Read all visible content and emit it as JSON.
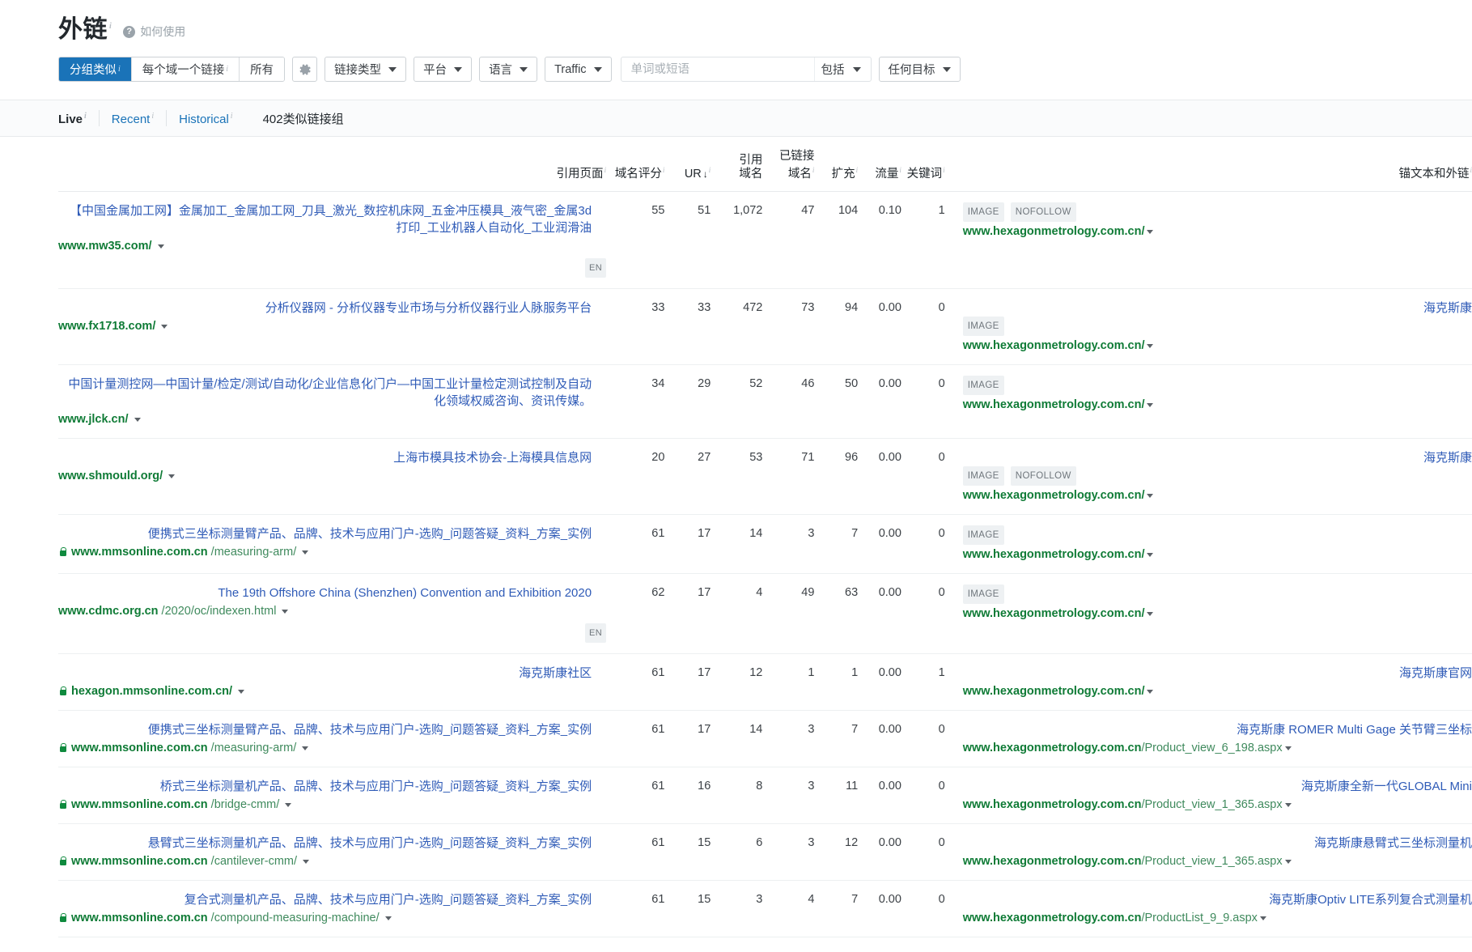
{
  "header": {
    "title": "外链",
    "title_sup": "i",
    "help_icon": "question-circle-icon",
    "help_label": "如何使用"
  },
  "toolbar": {
    "segments": [
      {
        "label": "分组类似",
        "sup": "i",
        "active": true
      },
      {
        "label": "每个域一个链接",
        "sup": "i",
        "active": false
      },
      {
        "label": "所有",
        "sup": "",
        "active": false
      }
    ],
    "gear_icon": "gear-icon",
    "dropdowns": [
      {
        "label": "链接类型"
      },
      {
        "label": "平台"
      },
      {
        "label": "语言"
      },
      {
        "label": "Traffic"
      }
    ],
    "search": {
      "placeholder": "单词或短语",
      "value": "",
      "mode_label": "包括"
    },
    "target_dropdown": {
      "label": "任何目标"
    }
  },
  "tabs": {
    "items": [
      {
        "label": "Live",
        "sup": "i",
        "active": true
      },
      {
        "label": "Recent",
        "sup": "i",
        "active": false
      },
      {
        "label": "Historical",
        "sup": "i",
        "active": false
      }
    ],
    "group_count": "402类似链接组"
  },
  "table": {
    "headers": [
      {
        "key": "page",
        "label": "引用页面",
        "sup": "i",
        "align": "left"
      },
      {
        "key": "dr",
        "label": "域名评分",
        "sup": "i",
        "align": "right"
      },
      {
        "key": "ur",
        "label": "UR",
        "sup": "i",
        "align": "right",
        "sorted": "desc",
        "sort_glyph": "↓"
      },
      {
        "key": "ref_domains",
        "label": "引用\n域名",
        "sup": "",
        "align": "right"
      },
      {
        "key": "linked_domains",
        "label": "已链接\n域名",
        "sup": "i",
        "align": "right"
      },
      {
        "key": "ext",
        "label": "扩充",
        "sup": "i",
        "align": "right"
      },
      {
        "key": "traffic",
        "label": "流量",
        "sup": "i",
        "align": "right"
      },
      {
        "key": "keywords",
        "label": "关键词",
        "sup": "i",
        "align": "right"
      },
      {
        "key": "anchor",
        "label": "锚文本和外链",
        "sup": "i",
        "align": "left"
      }
    ],
    "rows": [
      {
        "title": "【中国金属加工网】金属加工_金属加工网_刀具_激光_数控机床网_五金冲压模具_液气密_金属3d打印_工业机器人自动化_工业润滑油",
        "secure": false,
        "domain": "www.mw35.com/",
        "path": "",
        "lang": "EN",
        "dr": "55",
        "ur": "51",
        "ref_domains": "1,072",
        "linked_domains": "47",
        "ext": "104",
        "traffic": "0.10",
        "keywords": "1",
        "badges": [
          "IMAGE",
          "NOFOLLOW"
        ],
        "anchor_text": "",
        "anchor_domain": "www.hexagonmetrology.com.cn/",
        "anchor_path": ""
      },
      {
        "title": "分析仪器网 - 分析仪器专业市场与分析仪器行业人脉服务平台",
        "secure": false,
        "domain": "www.fx1718.com/",
        "path": "",
        "lang": "",
        "dr": "33",
        "ur": "33",
        "ref_domains": "472",
        "linked_domains": "73",
        "ext": "94",
        "traffic": "0.00",
        "keywords": "0",
        "badges": [
          "IMAGE"
        ],
        "anchor_text": "海克斯康",
        "anchor_domain": "www.hexagonmetrology.com.cn/",
        "anchor_path": ""
      },
      {
        "title": "中国计量测控网—中国计量/检定/测试/自动化/企业信息化门户—中国工业计量检定测试控制及自动化领域权威咨询、资讯传媒。",
        "secure": false,
        "domain": "www.jlck.cn/",
        "path": "",
        "lang": "",
        "dr": "34",
        "ur": "29",
        "ref_domains": "52",
        "linked_domains": "46",
        "ext": "50",
        "traffic": "0.00",
        "keywords": "0",
        "badges": [
          "IMAGE"
        ],
        "anchor_text": "",
        "anchor_domain": "www.hexagonmetrology.com.cn/",
        "anchor_path": ""
      },
      {
        "title": "上海市模具技术协会-上海模具信息网",
        "secure": false,
        "domain": "www.shmould.org/",
        "path": "",
        "lang": "",
        "dr": "20",
        "ur": "27",
        "ref_domains": "53",
        "linked_domains": "71",
        "ext": "96",
        "traffic": "0.00",
        "keywords": "0",
        "badges": [
          "IMAGE",
          "NOFOLLOW"
        ],
        "anchor_text": "海克斯康",
        "anchor_domain": "www.hexagonmetrology.com.cn/",
        "anchor_path": ""
      },
      {
        "title": "便携式三坐标测量臂产品、品牌、技术与应用门户-选购_问题答疑_资料_方案_实例",
        "secure": true,
        "domain": "www.mmsonline.com.cn",
        "path": "/measuring-arm/",
        "lang": "",
        "dr": "61",
        "ur": "17",
        "ref_domains": "14",
        "linked_domains": "3",
        "ext": "7",
        "traffic": "0.00",
        "keywords": "0",
        "badges": [
          "IMAGE"
        ],
        "anchor_text": "",
        "anchor_domain": "www.hexagonmetrology.com.cn/",
        "anchor_path": ""
      },
      {
        "title": "The 19th Offshore China (Shenzhen) Convention and Exhibition 2020",
        "secure": false,
        "domain": "www.cdmc.org.cn",
        "path": "/2020/oc/indexen.html",
        "lang": "EN",
        "dr": "62",
        "ur": "17",
        "ref_domains": "4",
        "linked_domains": "49",
        "ext": "63",
        "traffic": "0.00",
        "keywords": "0",
        "badges": [
          "IMAGE"
        ],
        "anchor_text": "",
        "anchor_domain": "www.hexagonmetrology.com.cn/",
        "anchor_path": ""
      },
      {
        "title": "海克斯康社区",
        "secure": true,
        "domain": "hexagon.mmsonline.com.cn/",
        "path": "",
        "lang": "",
        "dr": "61",
        "ur": "17",
        "ref_domains": "12",
        "linked_domains": "1",
        "ext": "1",
        "traffic": "0.00",
        "keywords": "1",
        "badges": [],
        "anchor_text": "海克斯康官网",
        "anchor_domain": "www.hexagonmetrology.com.cn/",
        "anchor_path": ""
      },
      {
        "title": "便携式三坐标测量臂产品、品牌、技术与应用门户-选购_问题答疑_资料_方案_实例",
        "secure": true,
        "domain": "www.mmsonline.com.cn",
        "path": "/measuring-arm/",
        "lang": "",
        "dr": "61",
        "ur": "17",
        "ref_domains": "14",
        "linked_domains": "3",
        "ext": "7",
        "traffic": "0.00",
        "keywords": "0",
        "badges": [],
        "anchor_text": "海克斯康 ROMER Multi Gage 关节臂三坐标",
        "anchor_domain": "www.hexagonmetrology.com.cn",
        "anchor_path": "/Product_view_6_198.aspx"
      },
      {
        "title": "桥式三坐标测量机产品、品牌、技术与应用门户-选购_问题答疑_资料_方案_实例",
        "secure": true,
        "domain": "www.mmsonline.com.cn",
        "path": "/bridge-cmm/",
        "lang": "",
        "dr": "61",
        "ur": "16",
        "ref_domains": "8",
        "linked_domains": "3",
        "ext": "11",
        "traffic": "0.00",
        "keywords": "0",
        "badges": [],
        "anchor_text": "海克斯康全新一代GLOBAL Mini",
        "anchor_domain": "www.hexagonmetrology.com.cn",
        "anchor_path": "/Product_view_1_365.aspx"
      },
      {
        "title": "悬臂式三坐标测量机产品、品牌、技术与应用门户-选购_问题答疑_资料_方案_实例",
        "secure": true,
        "domain": "www.mmsonline.com.cn",
        "path": "/cantilever-cmm/",
        "lang": "",
        "dr": "61",
        "ur": "15",
        "ref_domains": "6",
        "linked_domains": "3",
        "ext": "12",
        "traffic": "0.00",
        "keywords": "0",
        "badges": [],
        "anchor_text": "海克斯康悬臂式三坐标测量机",
        "anchor_domain": "www.hexagonmetrology.com.cn",
        "anchor_path": "/Product_view_1_365.aspx"
      },
      {
        "title": "复合式测量机产品、品牌、技术与应用门户-选购_问题答疑_资料_方案_实例",
        "secure": true,
        "domain": "www.mmsonline.com.cn",
        "path": "/compound-measuring-machine/",
        "lang": "",
        "dr": "61",
        "ur": "15",
        "ref_domains": "3",
        "linked_domains": "4",
        "ext": "7",
        "traffic": "0.00",
        "keywords": "0",
        "badges": [],
        "anchor_text": "海克斯康Optiv LITE系列复合式测量机",
        "anchor_domain": "www.hexagonmetrology.com.cn",
        "anchor_path": "/ProductList_9_9.aspx"
      }
    ]
  },
  "colors": {
    "accent": "#1a73b8",
    "link": "#2f5bb7",
    "url_green": "#0f7b36",
    "text": "#3c4146"
  }
}
